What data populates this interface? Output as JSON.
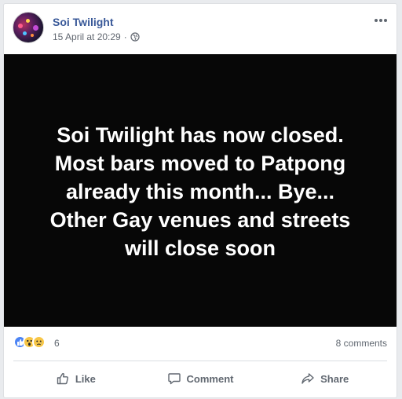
{
  "post": {
    "page_name": "Soi Twilight",
    "timestamp": "15 April at 20:29",
    "separator": "·",
    "privacy_icon": "globe-icon",
    "more_icon": "more-options-icon",
    "image_text": "Soi Twilight has now closed.\nMost bars moved to Patpong\nalready this month... Bye...\nOther Gay venues and streets\nwill close soon",
    "reactions": {
      "icons": [
        "like-reaction-icon",
        "wow-reaction-icon",
        "sad-reaction-icon"
      ],
      "count": "6"
    },
    "comments_count": "8 comments",
    "actions": {
      "like": "Like",
      "comment": "Comment",
      "share": "Share"
    }
  },
  "colors": {
    "page_name": "#385898",
    "meta_text": "#616770",
    "image_background": "#070707",
    "image_text": "#ffffff",
    "like_blue": "#4c84f4",
    "reaction_yellow": "#f7c647"
  }
}
